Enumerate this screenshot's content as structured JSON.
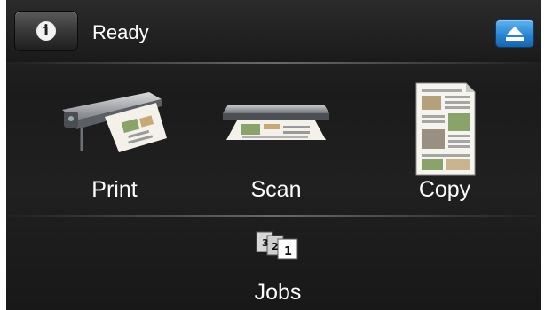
{
  "status": {
    "text": "Ready"
  },
  "home": {
    "tiles": [
      {
        "label": "Print",
        "icon": "large-format-printer-icon"
      },
      {
        "label": "Scan",
        "icon": "scanner-icon"
      },
      {
        "label": "Copy",
        "icon": "copy-document-icon"
      }
    ],
    "jobs": {
      "label": "Jobs",
      "icon": "job-queue-icon"
    }
  },
  "colors": {
    "accent": "#2a86d4",
    "background": "#1c1c1c",
    "text": "#ffffff"
  }
}
